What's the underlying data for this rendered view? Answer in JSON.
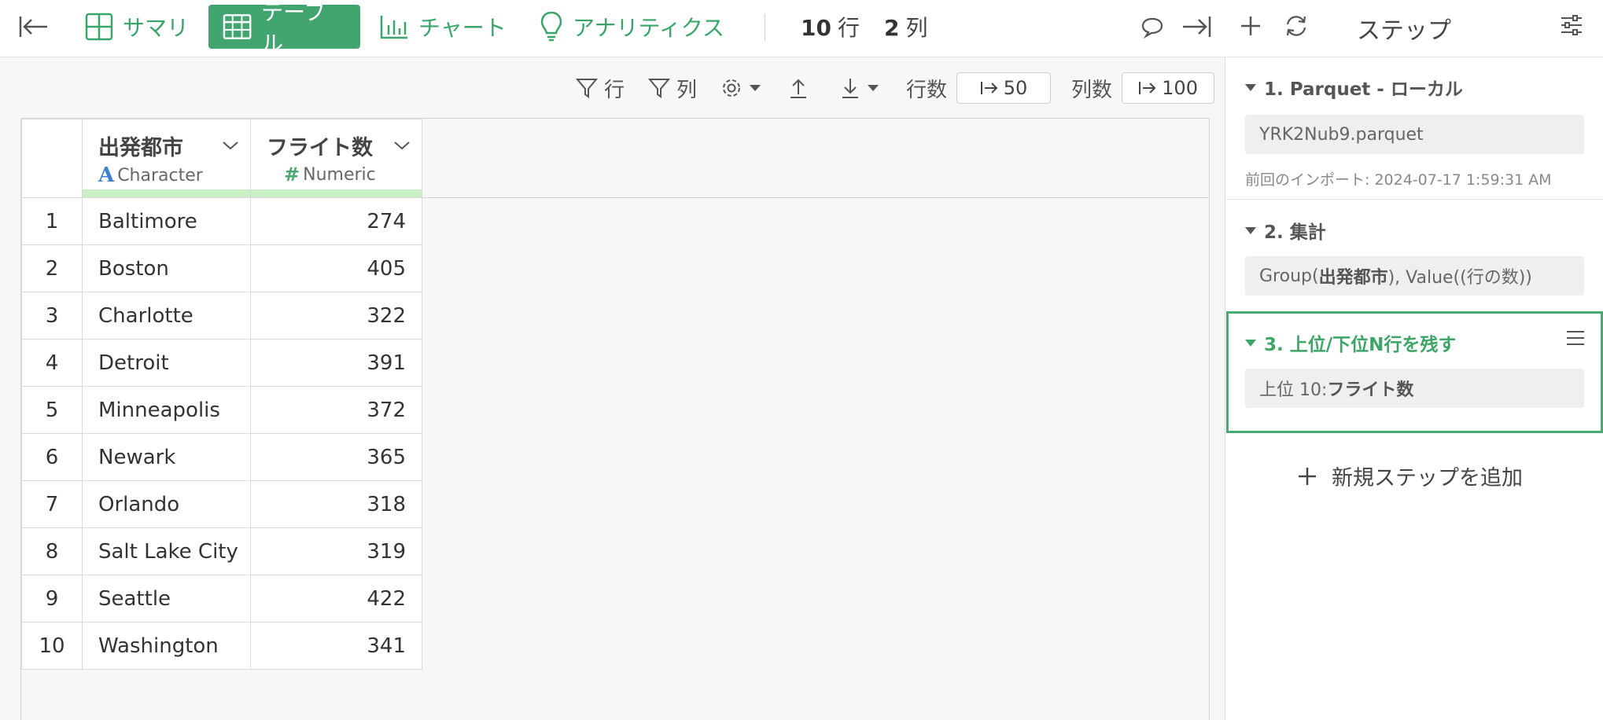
{
  "tabs": [
    {
      "label": "サマリ"
    },
    {
      "label": "テーブル"
    },
    {
      "label": "チャート"
    },
    {
      "label": "アナリティクス"
    }
  ],
  "counts": {
    "rows_value": "10",
    "rows_unit": "行",
    "cols_value": "2",
    "cols_unit": "列"
  },
  "toolbar": {
    "row_filter": "行",
    "col_filter": "列",
    "row_limit_label": "行数",
    "row_limit_value": "50",
    "col_limit_label": "列数",
    "col_limit_value": "100"
  },
  "table": {
    "columns": [
      {
        "name": "出発都市",
        "type_label": "Character",
        "type_glyph": "A"
      },
      {
        "name": "フライト数",
        "type_label": "Numeric",
        "type_glyph": "#"
      }
    ],
    "rows": [
      {
        "idx": "1",
        "city": "Baltimore",
        "flights": "274"
      },
      {
        "idx": "2",
        "city": "Boston",
        "flights": "405"
      },
      {
        "idx": "3",
        "city": "Charlotte",
        "flights": "322"
      },
      {
        "idx": "4",
        "city": "Detroit",
        "flights": "391"
      },
      {
        "idx": "5",
        "city": "Minneapolis",
        "flights": "372"
      },
      {
        "idx": "6",
        "city": "Newark",
        "flights": "365"
      },
      {
        "idx": "7",
        "city": "Orlando",
        "flights": "318"
      },
      {
        "idx": "8",
        "city": "Salt Lake City",
        "flights": "319"
      },
      {
        "idx": "9",
        "city": "Seattle",
        "flights": "422"
      },
      {
        "idx": "10",
        "city": "Washington",
        "flights": "341"
      }
    ]
  },
  "side": {
    "title": "ステップ",
    "steps": [
      {
        "title": "1. Parquet - ローカル",
        "body": "YRK2Nub9.parquet",
        "meta": "前回のインポート: 2024-07-17 1:59:31 AM"
      },
      {
        "title": "2. 集計",
        "body_pre": "Group(",
        "body_bold": "出発都市",
        "body_post": "), Value((行の数))"
      },
      {
        "title": "3. 上位/下位N行を残す",
        "body_pre": "上位 10: ",
        "body_bold": "フライト数"
      }
    ],
    "add_step": "新規ステップを追加"
  },
  "colors": {
    "accent": "#42a56f",
    "active_border": "#4aa96f",
    "col_bar": "#c8f0c4",
    "char_type": "#3c7fd0"
  }
}
